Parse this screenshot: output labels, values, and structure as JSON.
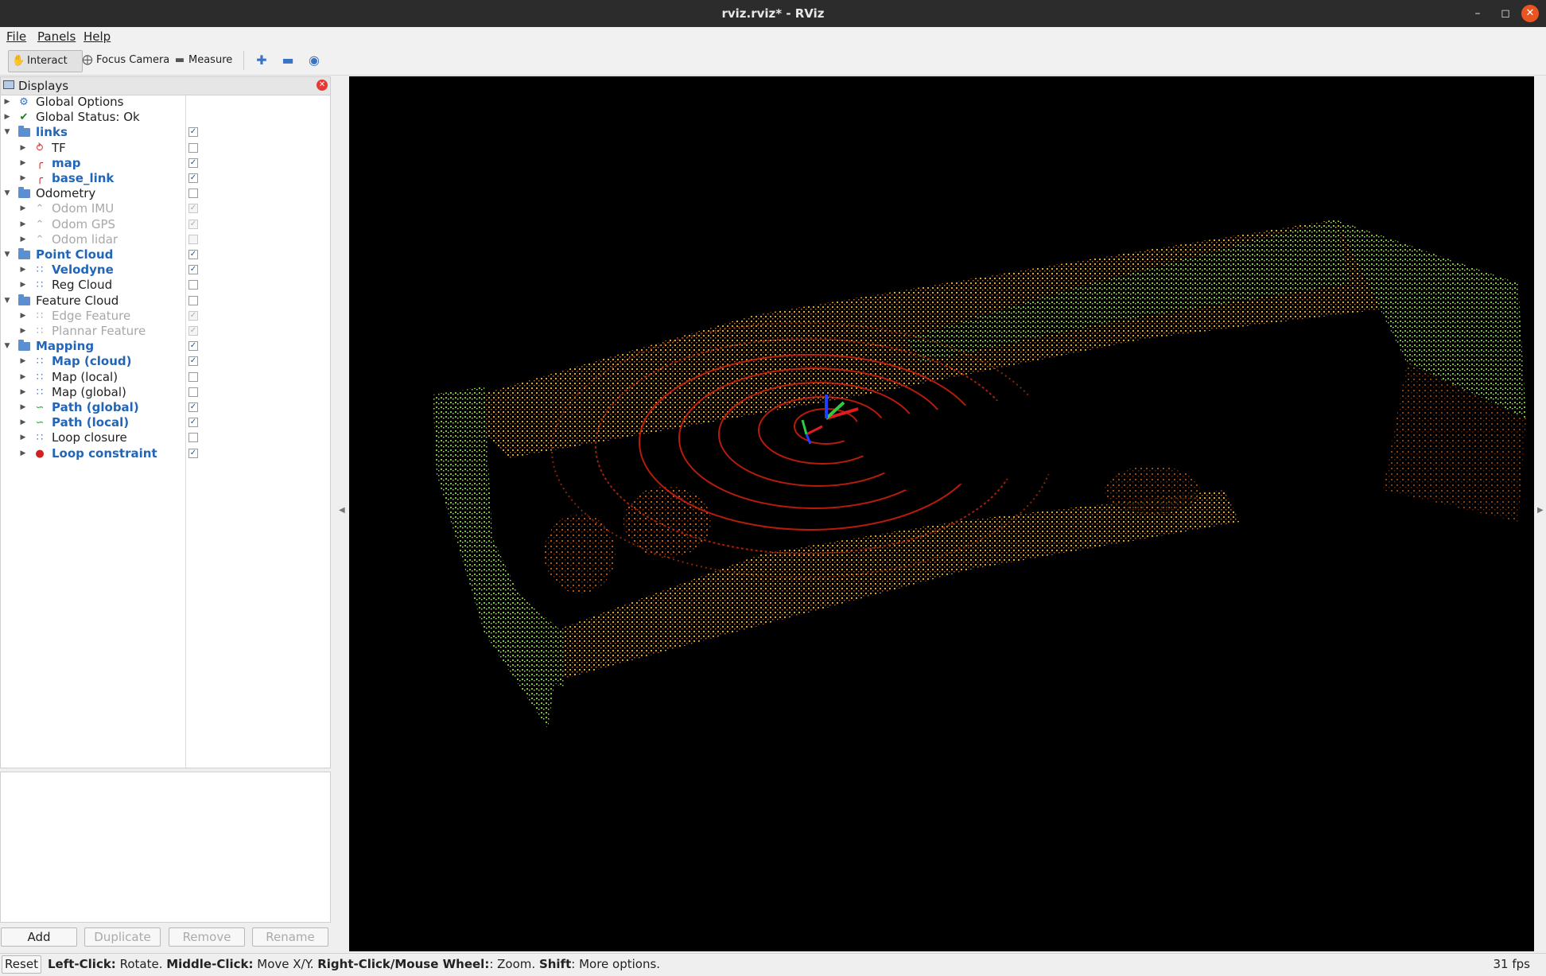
{
  "window": {
    "title": "rviz.rviz* - RViz"
  },
  "menu": {
    "file": "File",
    "panels": "Panels",
    "help": "Help"
  },
  "toolbar": {
    "interact": "Interact",
    "focus_camera": "Focus Camera",
    "measure": "Measure"
  },
  "displays": {
    "title": "Displays",
    "items": [
      {
        "label": "Global Options",
        "depth": 0,
        "style": "normal",
        "icon": "gear-icon",
        "checkbox": "none"
      },
      {
        "label": "Global Status: Ok",
        "depth": 0,
        "style": "normal",
        "icon": "check-icon",
        "checkbox": "none"
      },
      {
        "label": "links",
        "depth": 0,
        "style": "blue",
        "icon": "folder-icon",
        "checkbox": "checked",
        "expanded": true
      },
      {
        "label": "TF",
        "depth": 1,
        "style": "normal",
        "icon": "tf-icon",
        "checkbox": "unchecked"
      },
      {
        "label": "map",
        "depth": 1,
        "style": "blue",
        "icon": "axes-icon",
        "checkbox": "checked"
      },
      {
        "label": "base_link",
        "depth": 1,
        "style": "blue",
        "icon": "axes-icon",
        "checkbox": "checked"
      },
      {
        "label": "Odometry",
        "depth": 0,
        "style": "normal",
        "icon": "folder-icon",
        "checkbox": "unchecked",
        "expanded": true
      },
      {
        "label": "Odom IMU",
        "depth": 1,
        "style": "gray",
        "icon": "odometry-icon",
        "checkbox": "checked-disabled"
      },
      {
        "label": "Odom GPS",
        "depth": 1,
        "style": "gray",
        "icon": "odometry-icon",
        "checkbox": "checked-disabled"
      },
      {
        "label": "Odom lidar",
        "depth": 1,
        "style": "gray",
        "icon": "odometry-icon",
        "checkbox": "unchecked-disabled"
      },
      {
        "label": "Point Cloud",
        "depth": 0,
        "style": "blue",
        "icon": "folder-icon",
        "checkbox": "checked",
        "expanded": true
      },
      {
        "label": "Velodyne",
        "depth": 1,
        "style": "blue",
        "icon": "pointcloud-icon",
        "checkbox": "checked"
      },
      {
        "label": "Reg Cloud",
        "depth": 1,
        "style": "normal",
        "icon": "pointcloud-icon",
        "checkbox": "unchecked"
      },
      {
        "label": "Feature Cloud",
        "depth": 0,
        "style": "normal",
        "icon": "folder-icon",
        "checkbox": "unchecked",
        "expanded": true
      },
      {
        "label": "Edge Feature",
        "depth": 1,
        "style": "gray",
        "icon": "pointcloud-icon",
        "checkbox": "checked-disabled"
      },
      {
        "label": "Plannar Feature",
        "depth": 1,
        "style": "gray",
        "icon": "pointcloud-icon",
        "checkbox": "checked-disabled"
      },
      {
        "label": "Mapping",
        "depth": 0,
        "style": "blue",
        "icon": "folder-icon",
        "checkbox": "checked",
        "expanded": true
      },
      {
        "label": "Map (cloud)",
        "depth": 1,
        "style": "blue",
        "icon": "pointcloud-icon",
        "checkbox": "checked"
      },
      {
        "label": "Map (local)",
        "depth": 1,
        "style": "normal",
        "icon": "pointcloud-icon",
        "checkbox": "unchecked"
      },
      {
        "label": "Map (global)",
        "depth": 1,
        "style": "normal",
        "icon": "pointcloud-icon",
        "checkbox": "unchecked"
      },
      {
        "label": "Path (global)",
        "depth": 1,
        "style": "blue",
        "icon": "path-icon",
        "checkbox": "checked"
      },
      {
        "label": "Path (local)",
        "depth": 1,
        "style": "blue",
        "icon": "path-icon",
        "checkbox": "checked"
      },
      {
        "label": "Loop closure",
        "depth": 1,
        "style": "normal",
        "icon": "pointcloud-icon",
        "checkbox": "unchecked"
      },
      {
        "label": "Loop constraint",
        "depth": 1,
        "style": "blue",
        "icon": "marker-icon",
        "checkbox": "checked"
      }
    ]
  },
  "buttons": {
    "add": "Add",
    "duplicate": "Duplicate",
    "remove": "Remove",
    "rename": "Rename"
  },
  "status": {
    "reset": "Reset",
    "hint": [
      {
        "text": "Left-Click:",
        "bold": true
      },
      {
        "text": " Rotate. ",
        "bold": false
      },
      {
        "text": "Middle-Click:",
        "bold": true
      },
      {
        "text": " Move X/Y. ",
        "bold": false
      },
      {
        "text": "Right-Click/Mouse Wheel:",
        "bold": true
      },
      {
        "text": ": Zoom. ",
        "bold": false
      },
      {
        "text": "Shift",
        "bold": true
      },
      {
        "text": ": More options.",
        "bold": false
      }
    ],
    "fps": "31 fps"
  },
  "colors": {
    "accent": "#2366b8",
    "close": "#e95420",
    "viewport_bg": "#000000"
  }
}
